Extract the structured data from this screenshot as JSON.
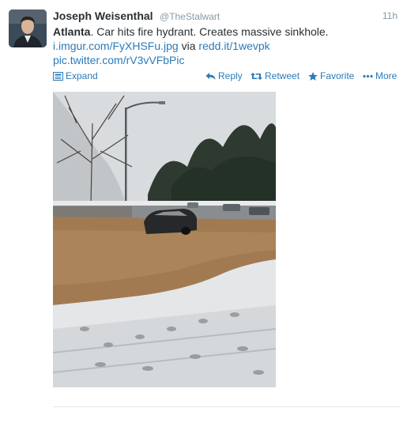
{
  "tweet": {
    "author_name": "Joseph Weisenthal",
    "author_handle": "@TheStalwart",
    "timestamp": "11h",
    "text_bold": "Atlanta",
    "text_rest": ". Car hits fire hydrant. Creates massive sinkhole.",
    "link1": "i.imgur.com/FyXHSFu.jpg",
    "via_word": "via",
    "link2": "redd.it/1wevpk",
    "link3": "pic.twitter.com/rV3vVFbPic"
  },
  "actions": {
    "expand": "Expand",
    "reply": "Reply",
    "retweet": "Retweet",
    "favorite": "Favorite",
    "more": "More"
  },
  "icons": {
    "expand": "expand-icon",
    "reply": "reply-icon",
    "retweet": "retweet-icon",
    "favorite": "star-icon",
    "more": "more-dots-icon"
  },
  "colors": {
    "link": "#2b7bb9",
    "text": "#292f33",
    "muted": "#8899a6",
    "divider": "#e1e8ed"
  }
}
